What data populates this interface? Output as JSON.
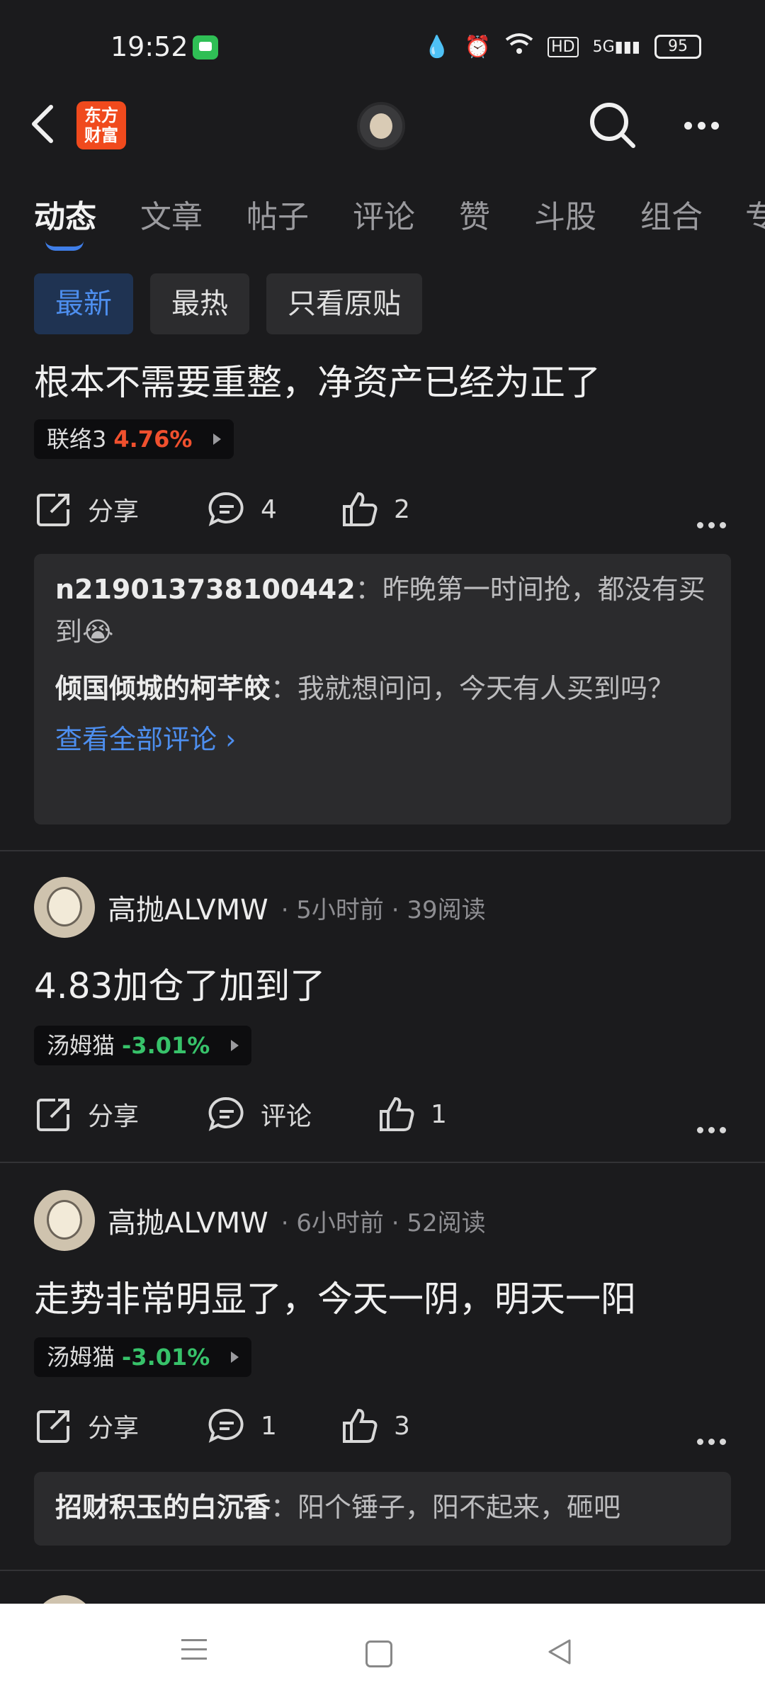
{
  "status": {
    "time": "19:52",
    "battery": "95",
    "net": "5G",
    "hd": "HD"
  },
  "header": {
    "logo_line1": "东方",
    "logo_line2": "财富"
  },
  "tabs": [
    "动态",
    "文章",
    "帖子",
    "评论",
    "赞",
    "斗股",
    "组合",
    "专"
  ],
  "filters": [
    "最新",
    "最热",
    "只看原贴"
  ],
  "post1": {
    "text": "根本不需要重整，净资产已经为正了",
    "stock": {
      "name": "联络3",
      "change": "4.76%"
    },
    "share": "分享",
    "comments": "4",
    "likes": "2",
    "comment_list": [
      {
        "name": "n219013738100442",
        "sep": "：",
        "text": "昨晚第一时间抢，都没有买到😭"
      },
      {
        "name": "倾国倾城的柯芊皎",
        "sep": "：",
        "text": "我就想问问，今天有人买到吗？"
      }
    ],
    "view_all": "查看全部评论"
  },
  "post2": {
    "user": "高抛ALVMW",
    "meta": " · 5小时前 · 39阅读",
    "text": "4.83加仓了加到了",
    "stock": {
      "name": "汤姆猫",
      "change": "-3.01%"
    },
    "share": "分享",
    "comments": "评论",
    "likes": "1"
  },
  "post3": {
    "user": "高抛ALVMW",
    "meta": " · 6小时前 · 52阅读",
    "text": "走势非常明显了，今天一阴，明天一阳",
    "stock": {
      "name": "汤姆猫",
      "change": "-3.01%"
    },
    "share": "分享",
    "comments": "1",
    "likes": "3",
    "comment_list": [
      {
        "name": "招财积玉的白沉香",
        "sep": "：",
        "text": "阳个锤子，阳不起来，砸吧"
      }
    ]
  }
}
